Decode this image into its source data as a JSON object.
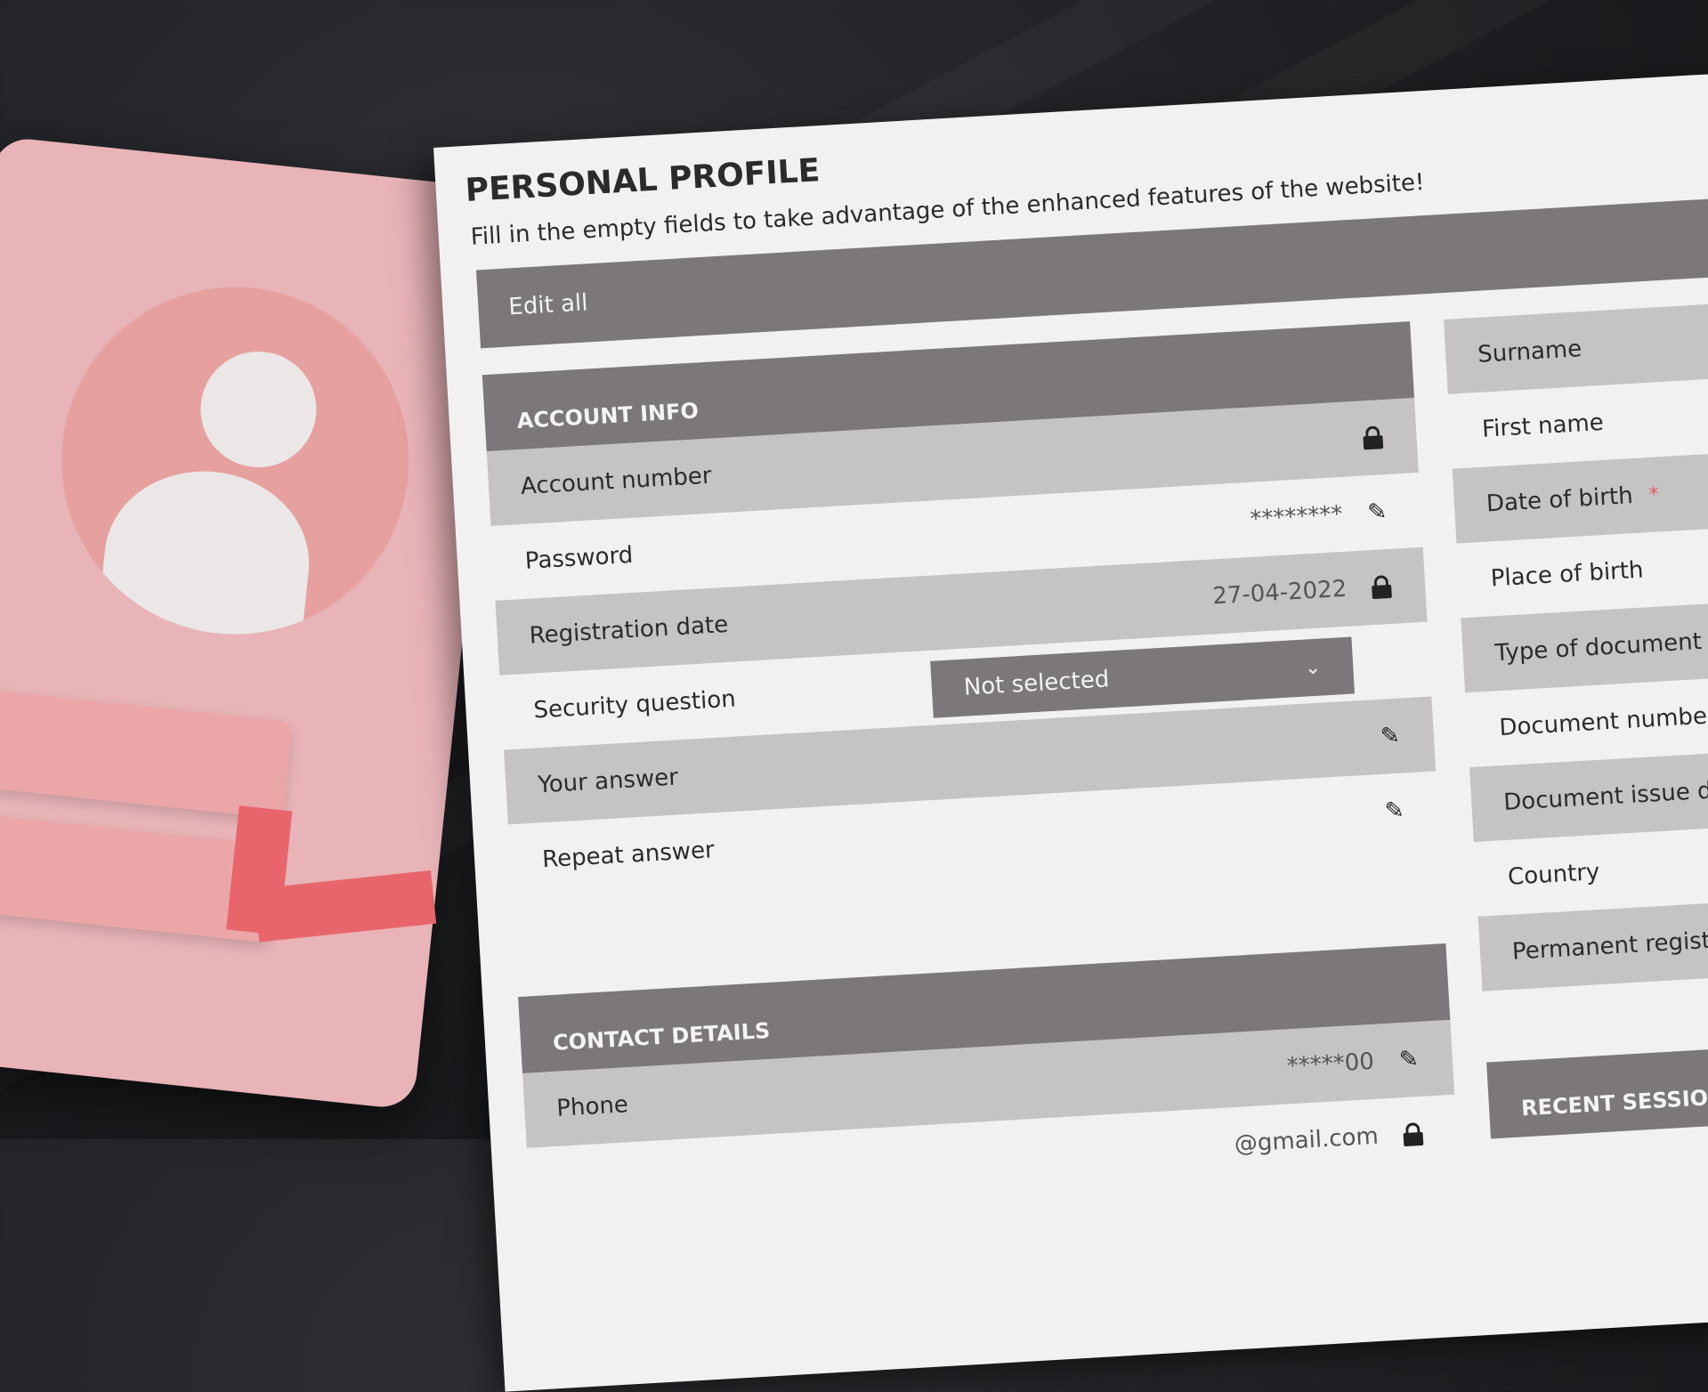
{
  "header": {
    "title": "PERSONAL PROFILE",
    "subtitle": "Fill in the empty fields to take advantage of the enhanced features of the website!"
  },
  "edit_all": "Edit all",
  "account_info": {
    "title": "ACCOUNT INFO",
    "rows": [
      {
        "label": "Account number",
        "value": "",
        "icon": "lock-icon"
      },
      {
        "label": "Password",
        "value": "********",
        "icon": "pencil-icon"
      },
      {
        "label": "Registration date",
        "value": "27-04-2022",
        "icon": "lock-icon"
      },
      {
        "label": "Security question",
        "select": "Not selected",
        "icon": "chevron-down-icon"
      },
      {
        "label": "Your answer",
        "value": "",
        "icon": "pencil-icon"
      },
      {
        "label": "Repeat answer",
        "value": "",
        "icon": "pencil-icon"
      }
    ]
  },
  "contact_details": {
    "title": "CONTACT DETAILS",
    "rows": [
      {
        "label": "Phone",
        "value": "*****00",
        "icon": "pencil-icon"
      },
      {
        "label": "",
        "value": "@gmail.com",
        "icon": "lock-icon"
      }
    ]
  },
  "personal": {
    "rows": [
      "Surname",
      "First name",
      "Date of birth",
      "Place of birth",
      "Type of document",
      "Document number",
      "Document issue da",
      "Country",
      "Permanent registe"
    ],
    "required_mark": "*"
  },
  "recent_sessions": {
    "title": "RECENT SESSIONS"
  },
  "colors": {
    "header_bar": "#7b777a",
    "row_alt": "#c5c3c4",
    "panel": "#f1f1f1",
    "accent_pink": "#e8666b",
    "background": "#1c1d20"
  }
}
